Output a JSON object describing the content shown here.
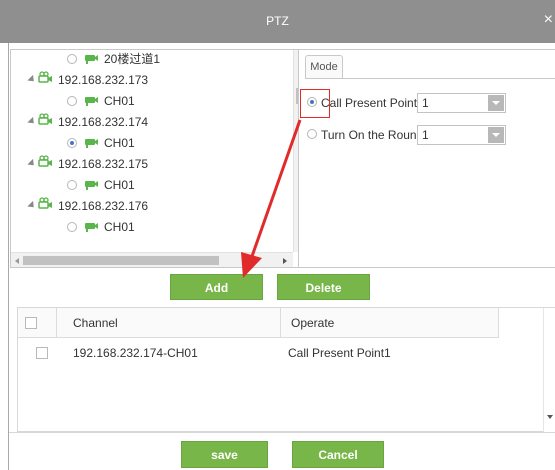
{
  "window": {
    "title": "PTZ",
    "close_glyph": "×"
  },
  "tree": {
    "items": [
      {
        "type": "channel",
        "label": "20楼过道1",
        "selected": false
      },
      {
        "type": "device",
        "label": "192.168.232.173"
      },
      {
        "type": "channel",
        "label": "CH01",
        "selected": false
      },
      {
        "type": "device",
        "label": "192.168.232.174"
      },
      {
        "type": "channel",
        "label": "CH01",
        "selected": true
      },
      {
        "type": "device",
        "label": "192.168.232.175"
      },
      {
        "type": "channel",
        "label": "CH01",
        "selected": false
      },
      {
        "type": "device",
        "label": "192.168.232.176"
      },
      {
        "type": "channel",
        "label": "CH01",
        "selected": false
      }
    ]
  },
  "mode": {
    "tab_label": "Mode",
    "options": [
      {
        "label": "Call Present Point",
        "value": "1",
        "checked": true
      },
      {
        "label": "Turn On the Round",
        "value": "1",
        "checked": false
      }
    ]
  },
  "buttons": {
    "add": "Add",
    "delete": "Delete",
    "save": "save",
    "cancel": "Cancel"
  },
  "table": {
    "columns": [
      "Channel",
      "Operate"
    ],
    "rows": [
      {
        "channel": "192.168.232.174-CH01",
        "operate": "Call Present Point1"
      }
    ]
  },
  "colors": {
    "titlebar": "#8f8f8f",
    "button_green": "#78b64a",
    "annotation_red": "#e12b2b",
    "device_icon_green": "#5ab54b"
  },
  "icons": {
    "device": "camera-group-icon",
    "channel": "camera-icon"
  }
}
